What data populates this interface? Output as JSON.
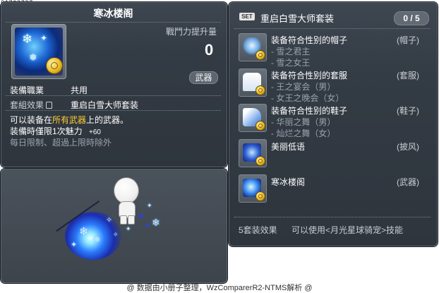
{
  "item_code": "01702737",
  "item": {
    "name": "寒冰楼阁",
    "stat_label": "戰鬥力提升量",
    "stat_value": "0",
    "category_badge": "武器",
    "job_label": "装備職業",
    "job_value": "共用",
    "set_label": "套組效果",
    "set_value": "重启白雪大师套装",
    "desc_prefix": "可以装备在",
    "desc_highlight": "所有武器",
    "desc_suffix": "上的武器。",
    "equip_limit": "装備時僅限1次魅力",
    "charm_value": "+60",
    "time_limit": "每日限制、超過上限時除外"
  },
  "set": {
    "badge": "SET",
    "name": "重启白雪大师套装",
    "count": "0 / 5",
    "items": [
      {
        "title": "装备符合性别的帽子",
        "options": [
          "- 雪之君主",
          "- 雪之女王"
        ],
        "type": "(帽子)"
      },
      {
        "title": "装备符合性别的套服",
        "options": [
          "- 王之宴会（男）",
          "- 女王之晚会（女）"
        ],
        "type": "(套服)"
      },
      {
        "title": "装备符合性别的鞋子",
        "options": [
          "- 华丽之舞（男）",
          "- 灿烂之舞（女）"
        ],
        "type": "(鞋子)"
      },
      {
        "title": "美丽低语",
        "options": [],
        "type": "(披风)"
      },
      {
        "title": "寒冰楼阁",
        "options": [],
        "type": "(武器)"
      }
    ],
    "effect_label": "5套装效果",
    "effect_value": "可以使用<月光星球骑宠>技能"
  },
  "footer": "@ 数据由小册子整理，WzComparerR2-NTMS解析 @",
  "colors": {
    "highlight": "#ffcc33",
    "panel": "#353c44",
    "text_grey": "#c9ced4"
  }
}
